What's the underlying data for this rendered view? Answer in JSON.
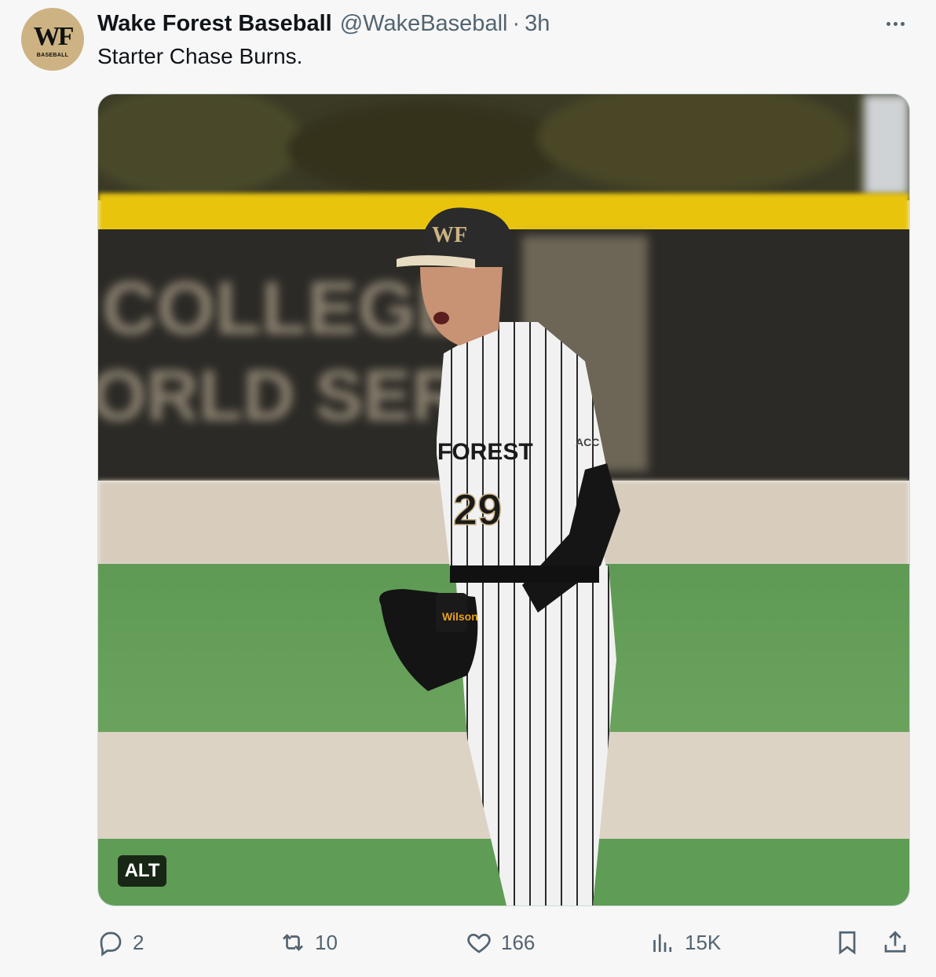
{
  "tweet": {
    "author_name": "Wake Forest Baseball",
    "handle": "@WakeBaseball",
    "separator": "·",
    "time": "3h",
    "text": "Starter Chase Burns.",
    "avatar": {
      "monogram": "WF",
      "subtitle": "BASEBALL",
      "color": "#cdb383"
    },
    "media": {
      "alt_label": "ALT",
      "wall_text_line1": "COLLEGE",
      "wall_text_line2": "ORLD SERIES",
      "cap_logo": "WF",
      "jersey_text": "FOREST",
      "jersey_number": "29",
      "sleeve_text": "ACC",
      "glove_text": "Wilson"
    }
  },
  "actions": {
    "replies": "2",
    "retweets": "10",
    "likes": "166",
    "views": "15K"
  },
  "icons": {
    "reply": "reply-icon",
    "retweet": "retweet-icon",
    "like": "heart-icon",
    "views": "views-icon",
    "bookmark": "bookmark-icon",
    "share": "share-icon",
    "more": "more-icon"
  }
}
